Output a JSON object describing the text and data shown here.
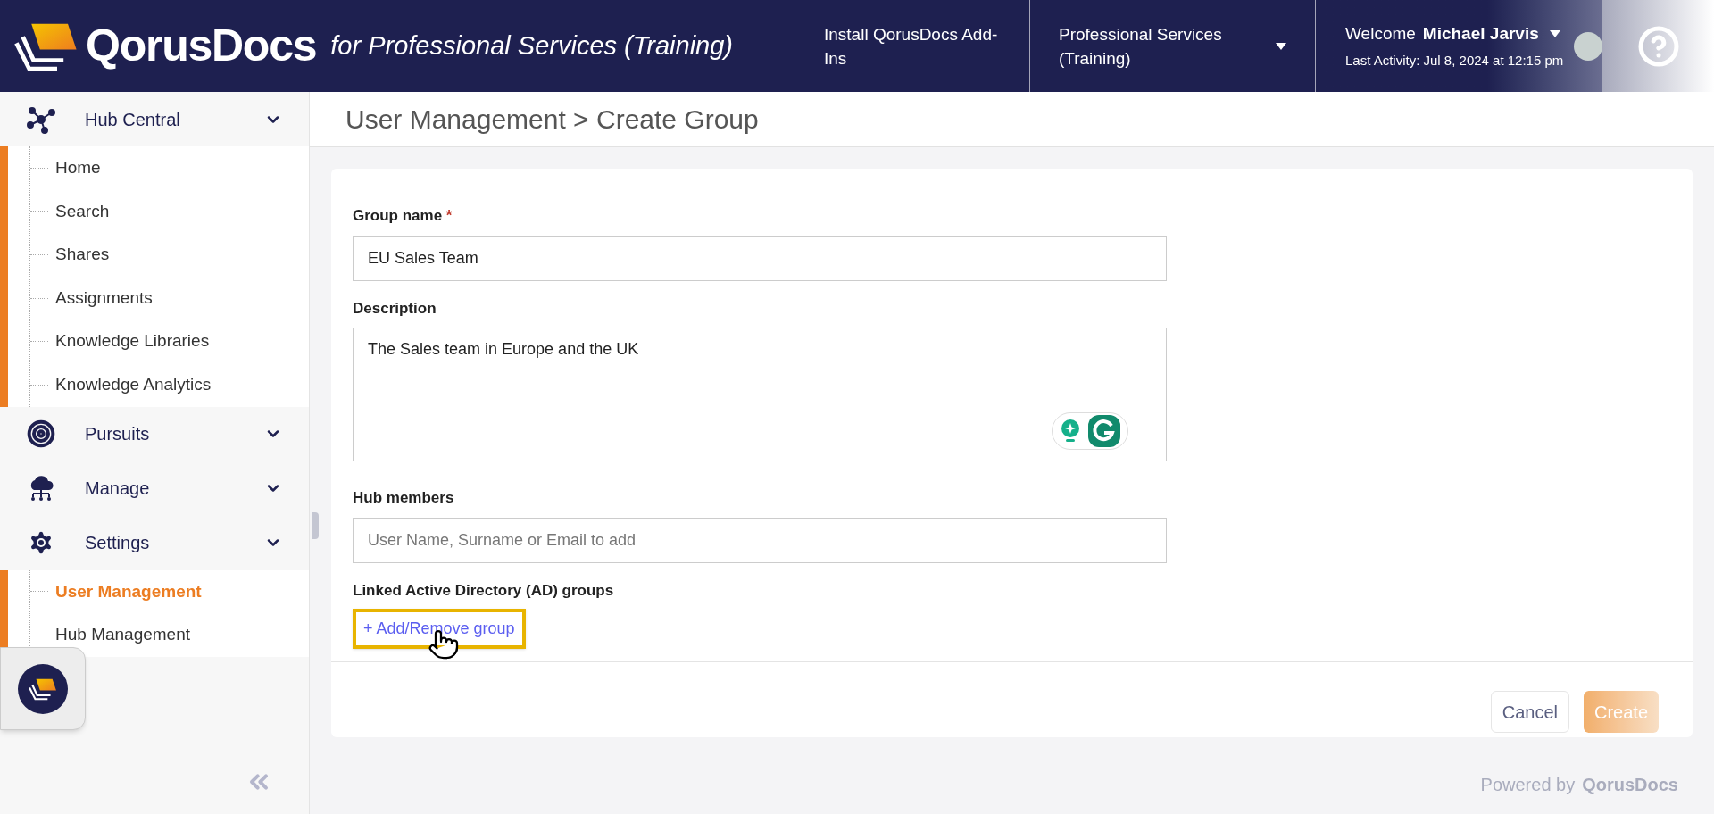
{
  "header": {
    "brand": "QorusDocs",
    "subtitle": "for Professional Services (Training)",
    "install_link": "Install QorusDocs Add-Ins",
    "workspace": {
      "label": "Professional Services (Training)"
    },
    "user": {
      "welcome": "Welcome",
      "name": "Michael Jarvis",
      "last_activity": "Last Activity: Jul 8, 2024 at 12:15 pm"
    }
  },
  "sidebar": {
    "sections": [
      {
        "label": "Hub Central",
        "expanded": true,
        "children": [
          {
            "label": "Home",
            "selected": false
          },
          {
            "label": "Search",
            "selected": false
          },
          {
            "label": "Shares",
            "selected": false
          },
          {
            "label": "Assignments",
            "selected": false
          },
          {
            "label": "Knowledge Libraries",
            "selected": false
          },
          {
            "label": "Knowledge Analytics",
            "selected": false
          }
        ]
      },
      {
        "label": "Pursuits",
        "expanded": false
      },
      {
        "label": "Manage",
        "expanded": false
      },
      {
        "label": "Settings",
        "expanded": true,
        "children": [
          {
            "label": "User Management",
            "selected": true
          },
          {
            "label": "Hub Management",
            "selected": false
          }
        ]
      }
    ]
  },
  "page_title": "User Management > Create Group",
  "form": {
    "group_name": {
      "label": "Group name",
      "required_mark": "*",
      "value": "EU Sales Team"
    },
    "description": {
      "label": "Description",
      "value": "The Sales team in Europe and the UK"
    },
    "hub_members": {
      "label": "Hub members",
      "placeholder": "User Name, Surname or Email to add"
    },
    "ad_groups": {
      "label": "Linked Active Directory (AD) groups",
      "link": "+ Add/Remove group",
      "highlighted": true
    }
  },
  "buttons": [
    {
      "kind": "secondary",
      "label": "Cancel",
      "disabled": false
    },
    {
      "kind": "primary",
      "label": "Create",
      "disabled": true
    }
  ],
  "footer": {
    "powered_by": "Powered by",
    "brand": "QorusDocs"
  }
}
